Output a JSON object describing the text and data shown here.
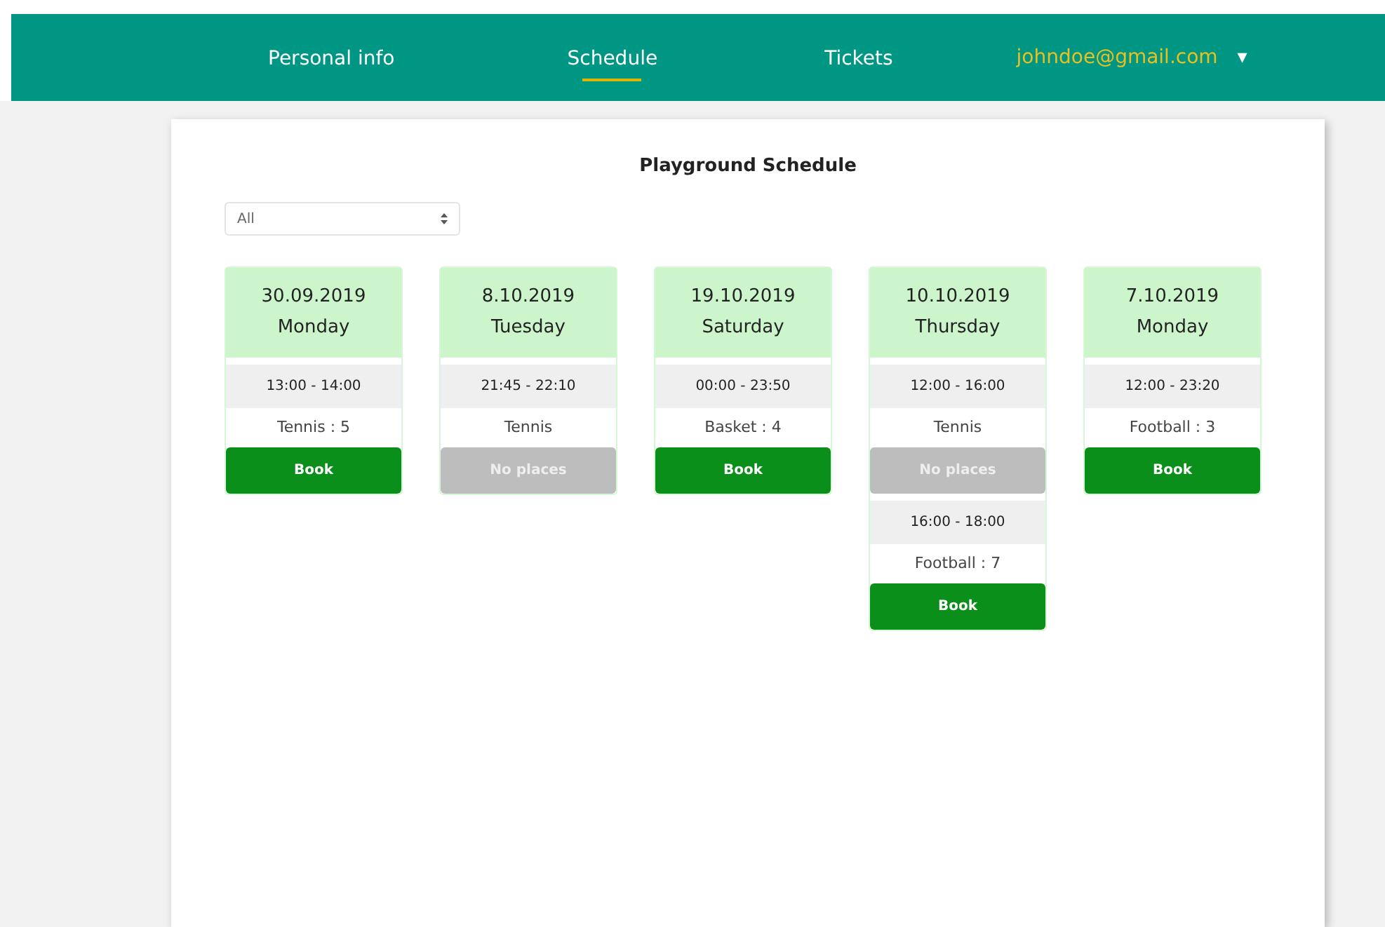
{
  "nav": {
    "items": [
      {
        "label": "Personal info",
        "selected": false
      },
      {
        "label": "Schedule",
        "selected": true
      },
      {
        "label": "Tickets",
        "selected": false
      }
    ],
    "account": {
      "email": "johndoe@gmail.com",
      "caret": "▾"
    }
  },
  "page": {
    "title": "Playground Schedule",
    "filter": {
      "value": "All"
    },
    "days": [
      {
        "date": "30.09.2019",
        "weekday": "Monday",
        "slots": [
          {
            "time": "13:00 - 14:00",
            "activity": "Tennis : 5",
            "button": {
              "label": "Book",
              "disabled": false
            }
          }
        ]
      },
      {
        "date": "8.10.2019",
        "weekday": "Tuesday",
        "slots": [
          {
            "time": "21:45 - 22:10",
            "activity": "Tennis",
            "button": {
              "label": "No places",
              "disabled": true
            }
          }
        ]
      },
      {
        "date": "19.10.2019",
        "weekday": "Saturday",
        "slots": [
          {
            "time": "00:00 - 23:50",
            "activity": "Basket : 4",
            "button": {
              "label": "Book",
              "disabled": false
            }
          }
        ]
      },
      {
        "date": "10.10.2019",
        "weekday": "Thursday",
        "slots": [
          {
            "time": "12:00 - 16:00",
            "activity": "Tennis",
            "button": {
              "label": "No places",
              "disabled": true
            }
          },
          {
            "time": "16:00 - 18:00",
            "activity": "Football : 7",
            "button": {
              "label": "Book",
              "disabled": false
            }
          }
        ]
      },
      {
        "date": "7.10.2019",
        "weekday": "Monday",
        "slots": [
          {
            "time": "12:00 - 23:20",
            "activity": "Football : 3",
            "button": {
              "label": "Book",
              "disabled": false
            }
          }
        ]
      }
    ]
  }
}
